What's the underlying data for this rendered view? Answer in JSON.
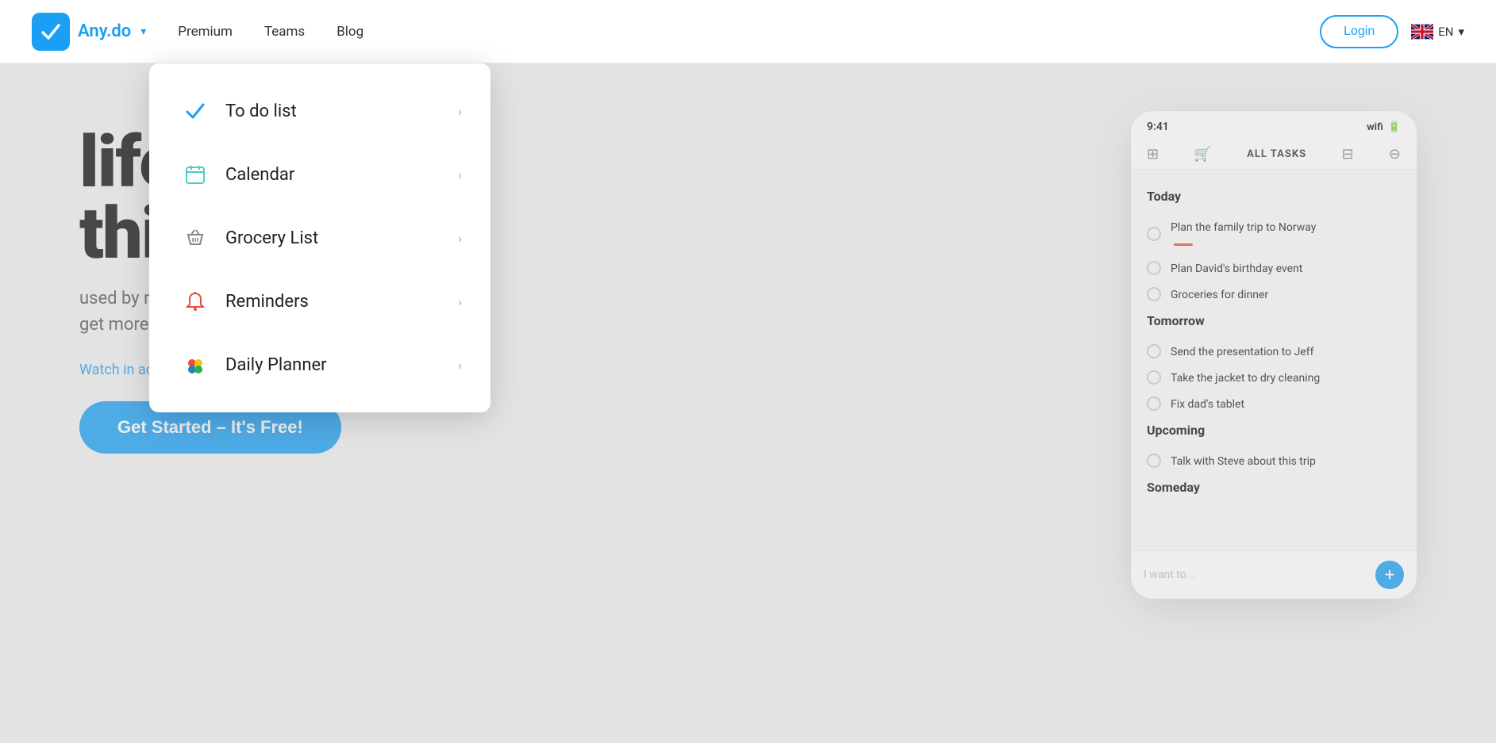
{
  "navbar": {
    "logo_text": "Any.do",
    "nav_links": [
      {
        "label": "Premium",
        "name": "nav-premium"
      },
      {
        "label": "Teams",
        "name": "nav-teams"
      },
      {
        "label": "Blog",
        "name": "nav-blog"
      }
    ],
    "login_label": "Login",
    "lang": "EN"
  },
  "dropdown": {
    "items": [
      {
        "label": "To do list",
        "icon": "checkmark",
        "name": "menu-todo"
      },
      {
        "label": "Calendar",
        "icon": "calendar",
        "name": "menu-calendar"
      },
      {
        "label": "Grocery List",
        "icon": "basket",
        "name": "menu-grocery"
      },
      {
        "label": "Reminders",
        "icon": "bell",
        "name": "menu-reminders"
      },
      {
        "label": "Daily Planner",
        "icon": "dots",
        "name": "menu-daily-planner"
      }
    ]
  },
  "hero": {
    "headline_line1": "life",
    "headline_line2": "this.",
    "subtext_line1": "used by millions",
    "subtext_line2": "get more done.",
    "watch_text": "Watch in action",
    "get_started": "Get Started – It's Free!"
  },
  "phone": {
    "time": "9:41",
    "toolbar_title": "ALL TASKS",
    "sections": [
      {
        "title": "Today",
        "tasks": [
          {
            "text": "Plan the family trip to Norway",
            "tag": "red"
          },
          {
            "text": "Plan David's birthday event",
            "tag": "none"
          },
          {
            "text": "Groceries for dinner",
            "tag": "none"
          }
        ]
      },
      {
        "title": "Tomorrow",
        "tasks": [
          {
            "text": "Send the presentation to Jeff",
            "tag": "none"
          },
          {
            "text": "Take the jacket to dry cleaning",
            "tag": "none"
          },
          {
            "text": "Fix dad's tablet",
            "tag": "none"
          }
        ]
      },
      {
        "title": "Upcoming",
        "tasks": [
          {
            "text": "Talk with Steve about this trip",
            "tag": "none"
          }
        ]
      },
      {
        "title": "Someday",
        "tasks": []
      }
    ],
    "input_placeholder": "I want to...",
    "add_icon": "+"
  }
}
